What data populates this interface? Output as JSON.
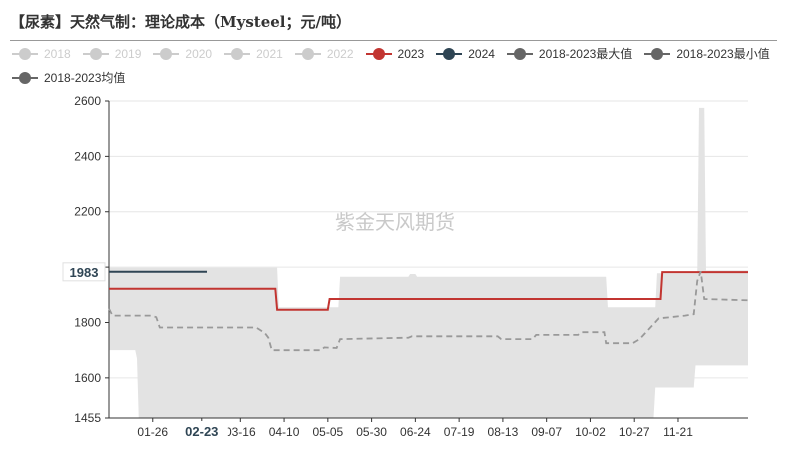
{
  "title": "【尿素】天然气制：理论成本（Mysteel；元/吨）",
  "watermark": "紫金天风期货",
  "legend": [
    {
      "label": "2018",
      "color": "#cccccc",
      "active": false
    },
    {
      "label": "2019",
      "color": "#cccccc",
      "active": false
    },
    {
      "label": "2020",
      "color": "#cccccc",
      "active": false
    },
    {
      "label": "2021",
      "color": "#cccccc",
      "active": false
    },
    {
      "label": "2022",
      "color": "#cccccc",
      "active": false
    },
    {
      "label": "2023",
      "color": "#c23531",
      "active": true
    },
    {
      "label": "2024",
      "color": "#2f4554",
      "active": true
    },
    {
      "label": "2018-2023最大值",
      "color": "#666666",
      "active": true
    },
    {
      "label": "2018-2023最小值",
      "color": "#666666",
      "active": true
    },
    {
      "label": "2018-2023均值",
      "color": "#666666",
      "active": true
    }
  ],
  "chart_data": {
    "type": "line",
    "title": "【尿素】天然气制：理论成本（Mysteel；元/吨）",
    "ylim": [
      1455,
      2600
    ],
    "yticks": [
      1455,
      1600,
      1800,
      2000,
      2200,
      2400,
      2600
    ],
    "xlim": [
      "01-01",
      "12-31"
    ],
    "xticks": [
      "01-26",
      "02-23",
      "03-16",
      "04-10",
      "05-05",
      "05-30",
      "06-24",
      "07-19",
      "08-13",
      "09-07",
      "10-02",
      "10-27",
      "11-21"
    ],
    "axis_pointer": {
      "x": "02-23",
      "y": "1983"
    },
    "band": {
      "max": [
        [
          "01-01",
          1998
        ],
        [
          "04-06",
          1998
        ],
        [
          "04-07",
          1855
        ],
        [
          "05-11",
          1855
        ],
        [
          "05-12",
          1965
        ],
        [
          "06-20",
          1965
        ],
        [
          "06-21",
          1975
        ],
        [
          "06-24",
          1975
        ],
        [
          "06-25",
          1965
        ],
        [
          "10-11",
          1965
        ],
        [
          "10-12",
          1855
        ],
        [
          "11-08",
          1855
        ],
        [
          "11-09",
          1978
        ],
        [
          "12-02",
          1978
        ],
        [
          "12-03",
          2575
        ],
        [
          "12-06",
          2575
        ],
        [
          "12-07",
          1988
        ],
        [
          "12-31",
          1988
        ]
      ],
      "min": [
        [
          "01-01",
          1700
        ],
        [
          "01-16",
          1700
        ],
        [
          "01-17",
          1670
        ],
        [
          "01-18",
          1455
        ],
        [
          "11-07",
          1455
        ],
        [
          "11-08",
          1565
        ],
        [
          "11-30",
          1565
        ],
        [
          "12-01",
          1645
        ],
        [
          "12-31",
          1645
        ]
      ]
    },
    "series": [
      {
        "name": "2023",
        "color": "#c23531",
        "style": "solid",
        "points": [
          [
            "01-01",
            1922
          ],
          [
            "04-05",
            1922
          ],
          [
            "04-06",
            1846
          ],
          [
            "05-05",
            1846
          ],
          [
            "05-06",
            1885
          ],
          [
            "11-11",
            1885
          ],
          [
            "11-12",
            1982
          ],
          [
            "12-31",
            1982
          ]
        ]
      },
      {
        "name": "2024",
        "color": "#2f4554",
        "style": "solid",
        "points": [
          [
            "01-01",
            1983
          ],
          [
            "02-26",
            1983
          ]
        ]
      },
      {
        "name": "2018-2023均值",
        "color": "#999999",
        "style": "dashed",
        "points": [
          [
            "01-01",
            1850
          ],
          [
            "01-03",
            1825
          ],
          [
            "01-25",
            1825
          ],
          [
            "01-28",
            1819
          ],
          [
            "01-30",
            1782
          ],
          [
            "03-14",
            1782
          ],
          [
            "03-25",
            1782
          ],
          [
            "03-30",
            1762
          ],
          [
            "04-01",
            1745
          ],
          [
            "04-03",
            1700
          ],
          [
            "04-20",
            1700
          ],
          [
            "05-01",
            1700
          ],
          [
            "05-03",
            1710
          ],
          [
            "05-10",
            1708
          ],
          [
            "05-12",
            1740
          ],
          [
            "06-20",
            1745
          ],
          [
            "06-22",
            1750
          ],
          [
            "08-10",
            1750
          ],
          [
            "08-12",
            1740
          ],
          [
            "08-30",
            1740
          ],
          [
            "09-01",
            1755
          ],
          [
            "09-25",
            1755
          ],
          [
            "09-27",
            1765
          ],
          [
            "10-10",
            1765
          ],
          [
            "10-11",
            1725
          ],
          [
            "10-26",
            1725
          ],
          [
            "10-30",
            1740
          ],
          [
            "11-10",
            1815
          ],
          [
            "11-15",
            1818
          ],
          [
            "11-25",
            1825
          ],
          [
            "11-30",
            1830
          ],
          [
            "12-02",
            1950
          ],
          [
            "12-04",
            1985
          ],
          [
            "12-06",
            1885
          ],
          [
            "12-31",
            1880
          ]
        ]
      }
    ]
  }
}
